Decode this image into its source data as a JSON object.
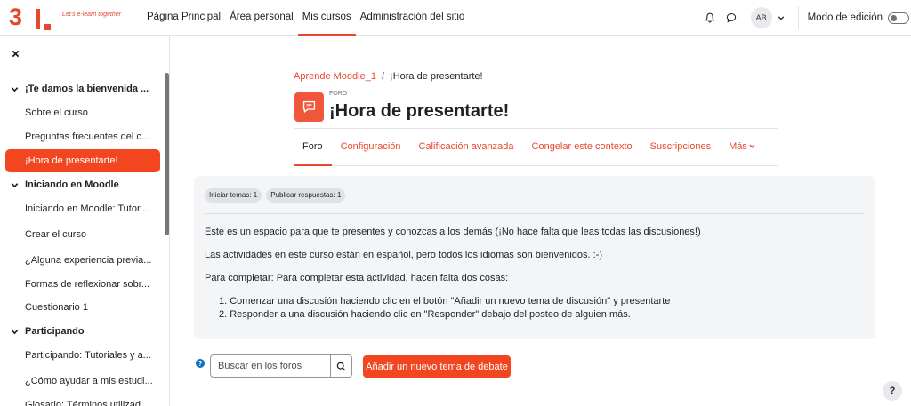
{
  "brand": {
    "logo_text": "3",
    "tagline": "Let's e-learn together"
  },
  "nav": {
    "items": [
      {
        "label": "Página Principal",
        "active": false
      },
      {
        "label": "Área personal",
        "active": false
      },
      {
        "label": "Mis cursos",
        "active": true
      },
      {
        "label": "Administración del sitio",
        "active": false
      }
    ],
    "avatar_initials": "AB",
    "edit_mode_label": "Modo de edición",
    "edit_mode_on": false
  },
  "sidebar": {
    "sections": [
      {
        "title": "¡Te damos la bienvenida ...",
        "items": [
          "Sobre el curso",
          "Preguntas frecuentes del c...",
          "¡Hora de presentarte!"
        ]
      },
      {
        "title": "Iniciando en Moodle",
        "items": [
          "Iniciando en Moodle: Tutor...",
          "Crear el curso",
          "¿Alguna experiencia previa...",
          "Formas de reflexionar sobr...",
          "Cuestionario 1"
        ]
      },
      {
        "title": "Participando",
        "items": [
          "Participando: Tutoriales y a...",
          "¿Cómo ayudar a mis estudi...",
          "Glosario: Términos utilizad..."
        ]
      }
    ],
    "active_item": "¡Hora de presentarte!"
  },
  "breadcrumb": {
    "course": "Aprende Moodle_1",
    "separator": "/",
    "current": "¡Hora de presentarte!"
  },
  "activity": {
    "type_label": "FORO",
    "title": "¡Hora de presentarte!"
  },
  "tabs": [
    {
      "label": "Foro",
      "active": true
    },
    {
      "label": "Configuración",
      "active": false
    },
    {
      "label": "Calificación avanzada",
      "active": false
    },
    {
      "label": "Congelar este contexto",
      "active": false
    },
    {
      "label": "Suscripciones",
      "active": false
    },
    {
      "label": "Más",
      "active": false
    }
  ],
  "completion": {
    "badges": [
      "Iniciar temas: 1",
      "Publicar respuestas: 1"
    ]
  },
  "description": {
    "paragraphs": [
      "Este es un espacio para que te presentes y conozcas a los demás (¡No hace falta que leas todas las discusiones!)",
      "Las actividades en este curso están en español, pero todos los idiomas son bienvenidos. :-)",
      "Para completar: Para completar esta actividad, hacen falta dos cosas:"
    ],
    "list": [
      "1. Comenzar una discusión haciendo clic en el botón \"Añadir un nuevo tema de discusión\" y presentarte",
      "2. Responder a una discusión haciendo clic en \"Responder\" debajo del posteo de alguien más."
    ]
  },
  "search": {
    "placeholder": "Buscar en los foros"
  },
  "actions": {
    "add_topic": "Añadir un nuevo tema de debate"
  },
  "help_fab": "?",
  "colors": {
    "accent": "#f1461f",
    "link": "#e8472c",
    "panel_bg": "#f4f5f7"
  }
}
